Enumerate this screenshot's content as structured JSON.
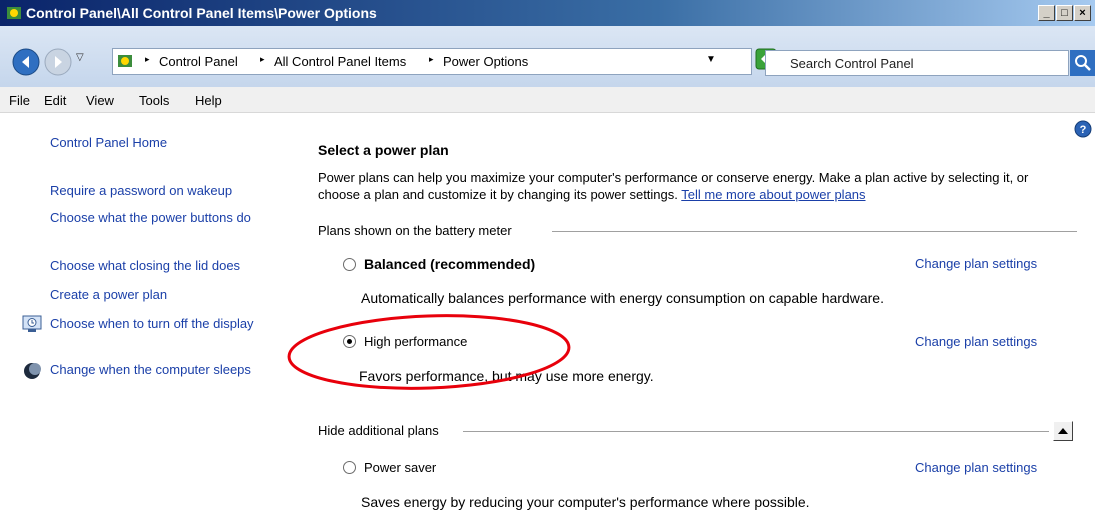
{
  "window": {
    "title": "Control Panel\\All Control Panel Items\\Power Options",
    "buttons": [
      "_",
      "□",
      "×"
    ]
  },
  "address_bar": {
    "crumbs": [
      "Control Panel",
      "All Control Panel Items",
      "Power Options"
    ],
    "separator": "▸"
  },
  "search": {
    "placeholder": "Search Control Panel"
  },
  "menu": [
    "File",
    "Edit",
    "View",
    "Tools",
    "Help"
  ],
  "sidebar": {
    "home": "Control Panel Home",
    "links": [
      "Require a password on wakeup",
      "Choose what the power buttons do",
      "Choose what closing the lid does",
      "Create a power plan",
      "Choose when to turn off the display",
      "Change when the computer sleeps"
    ]
  },
  "main": {
    "heading": "Select a power plan",
    "description": "Power plans can help you maximize your computer's performance or conserve energy. Make a plan active by selecting it, or choose a plan and customize it by changing its power settings.",
    "more_link": "Tell me more about power plans",
    "battery_section": "Plans shown on the battery meter",
    "additional_section": "Hide additional plans",
    "change_label": "Change plan settings",
    "plans": [
      {
        "name": "Balanced (recommended)",
        "desc": "Automatically balances performance with energy consumption on capable hardware.",
        "selected": false
      },
      {
        "name": "High performance",
        "desc": "Favors performance, but may use more energy.",
        "selected": true
      },
      {
        "name": "Power saver",
        "desc": "Saves energy by reducing your computer's performance where possible.",
        "selected": false
      }
    ]
  },
  "colors": {
    "link": "#1a3fa8",
    "annotation": "#e8000b",
    "titlebar": "#0a246a"
  }
}
